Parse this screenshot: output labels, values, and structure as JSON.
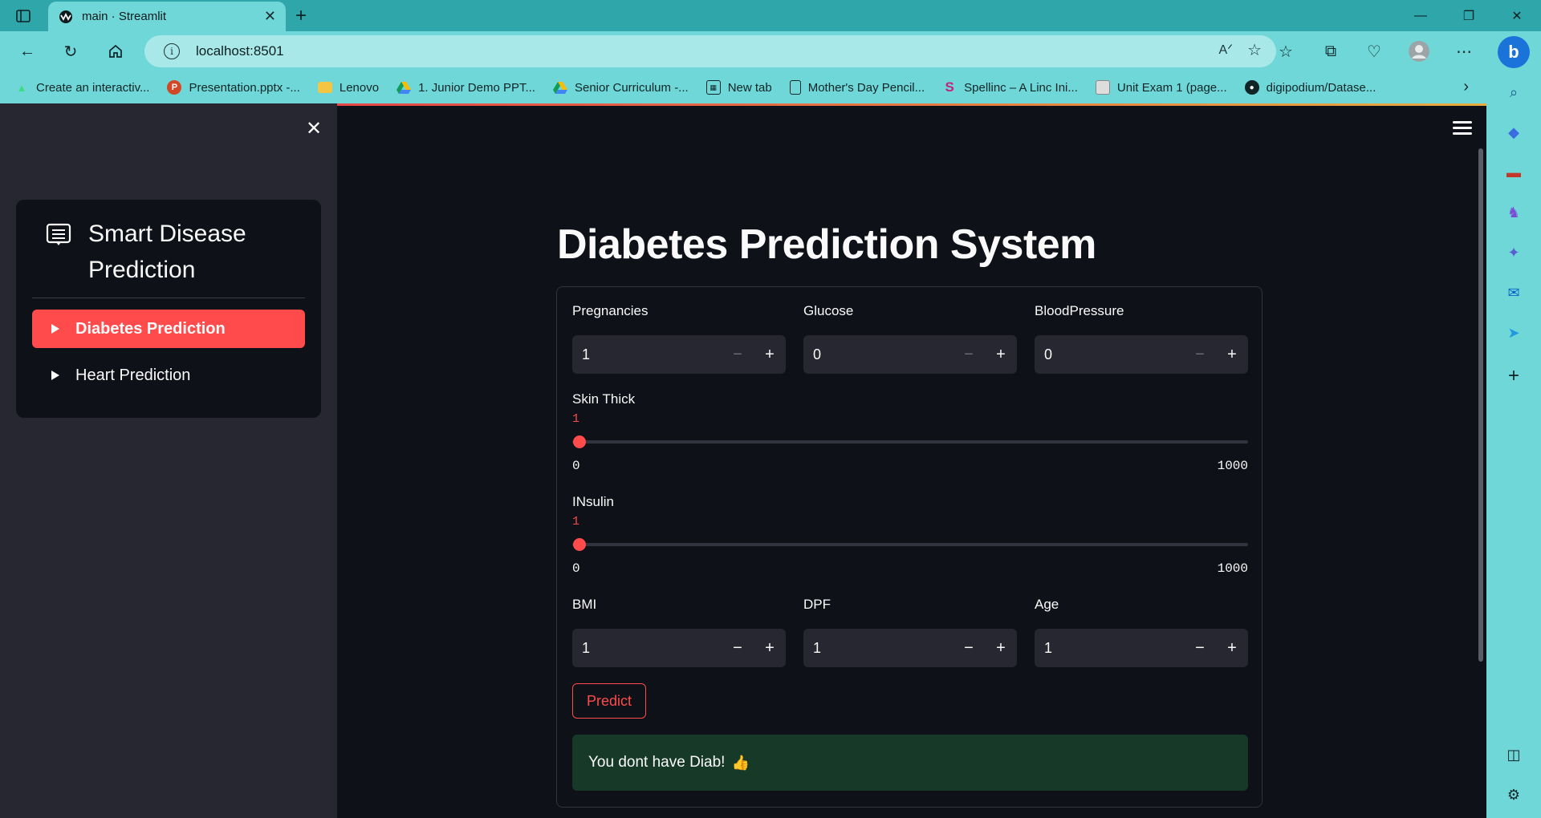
{
  "browser": {
    "tab_title": "main · Streamlit",
    "url": "localhost:8501",
    "bookmarks": [
      {
        "label": "Create an interactiv...",
        "icon": "android-icon"
      },
      {
        "label": "Presentation.pptx -...",
        "icon": "powerpoint-icon"
      },
      {
        "label": "Lenovo",
        "icon": "folder-icon"
      },
      {
        "label": "1. Junior Demo PPT...",
        "icon": "drive-icon"
      },
      {
        "label": "Senior Curriculum -...",
        "icon": "drive-icon"
      },
      {
        "label": "New tab",
        "icon": "newtab-icon"
      },
      {
        "label": "Mother's Day Pencil...",
        "icon": "document-icon"
      },
      {
        "label": "Spellinc – A Linc Ini...",
        "icon": "spellinc-icon"
      },
      {
        "label": "Unit Exam 1 (page...",
        "icon": "page-icon"
      },
      {
        "label": "digipodium/Datase...",
        "icon": "github-icon"
      }
    ]
  },
  "sidebar": {
    "menu_title": "Smart Disease Prediction",
    "items": [
      {
        "label": "Diabetes Prediction",
        "active": true
      },
      {
        "label": "Heart Prediction",
        "active": false
      }
    ]
  },
  "main": {
    "title": "Diabetes Prediction System",
    "fields": {
      "pregnancies": {
        "label": "Pregnancies",
        "value": "1"
      },
      "glucose": {
        "label": "Glucose",
        "value": "0"
      },
      "bloodpressure": {
        "label": "BloodPressure",
        "value": "0"
      },
      "bmi": {
        "label": "BMI",
        "value": "1"
      },
      "dpf": {
        "label": "DPF",
        "value": "1"
      },
      "age": {
        "label": "Age",
        "value": "1"
      }
    },
    "sliders": {
      "skin": {
        "label": "Skin Thick",
        "value": "1",
        "min": "0",
        "max": "1000"
      },
      "insulin": {
        "label": "INsulin",
        "value": "1",
        "min": "0",
        "max": "1000"
      }
    },
    "predict_label": "Predict",
    "result_text": "You dont have Diab!",
    "result_emoji": "👍"
  },
  "colors": {
    "primary": "#ff4b4b",
    "background": "#0e1117",
    "sidebar": "#262730",
    "success_bg": "#173928",
    "browser_accent": "#6fd7d8"
  }
}
